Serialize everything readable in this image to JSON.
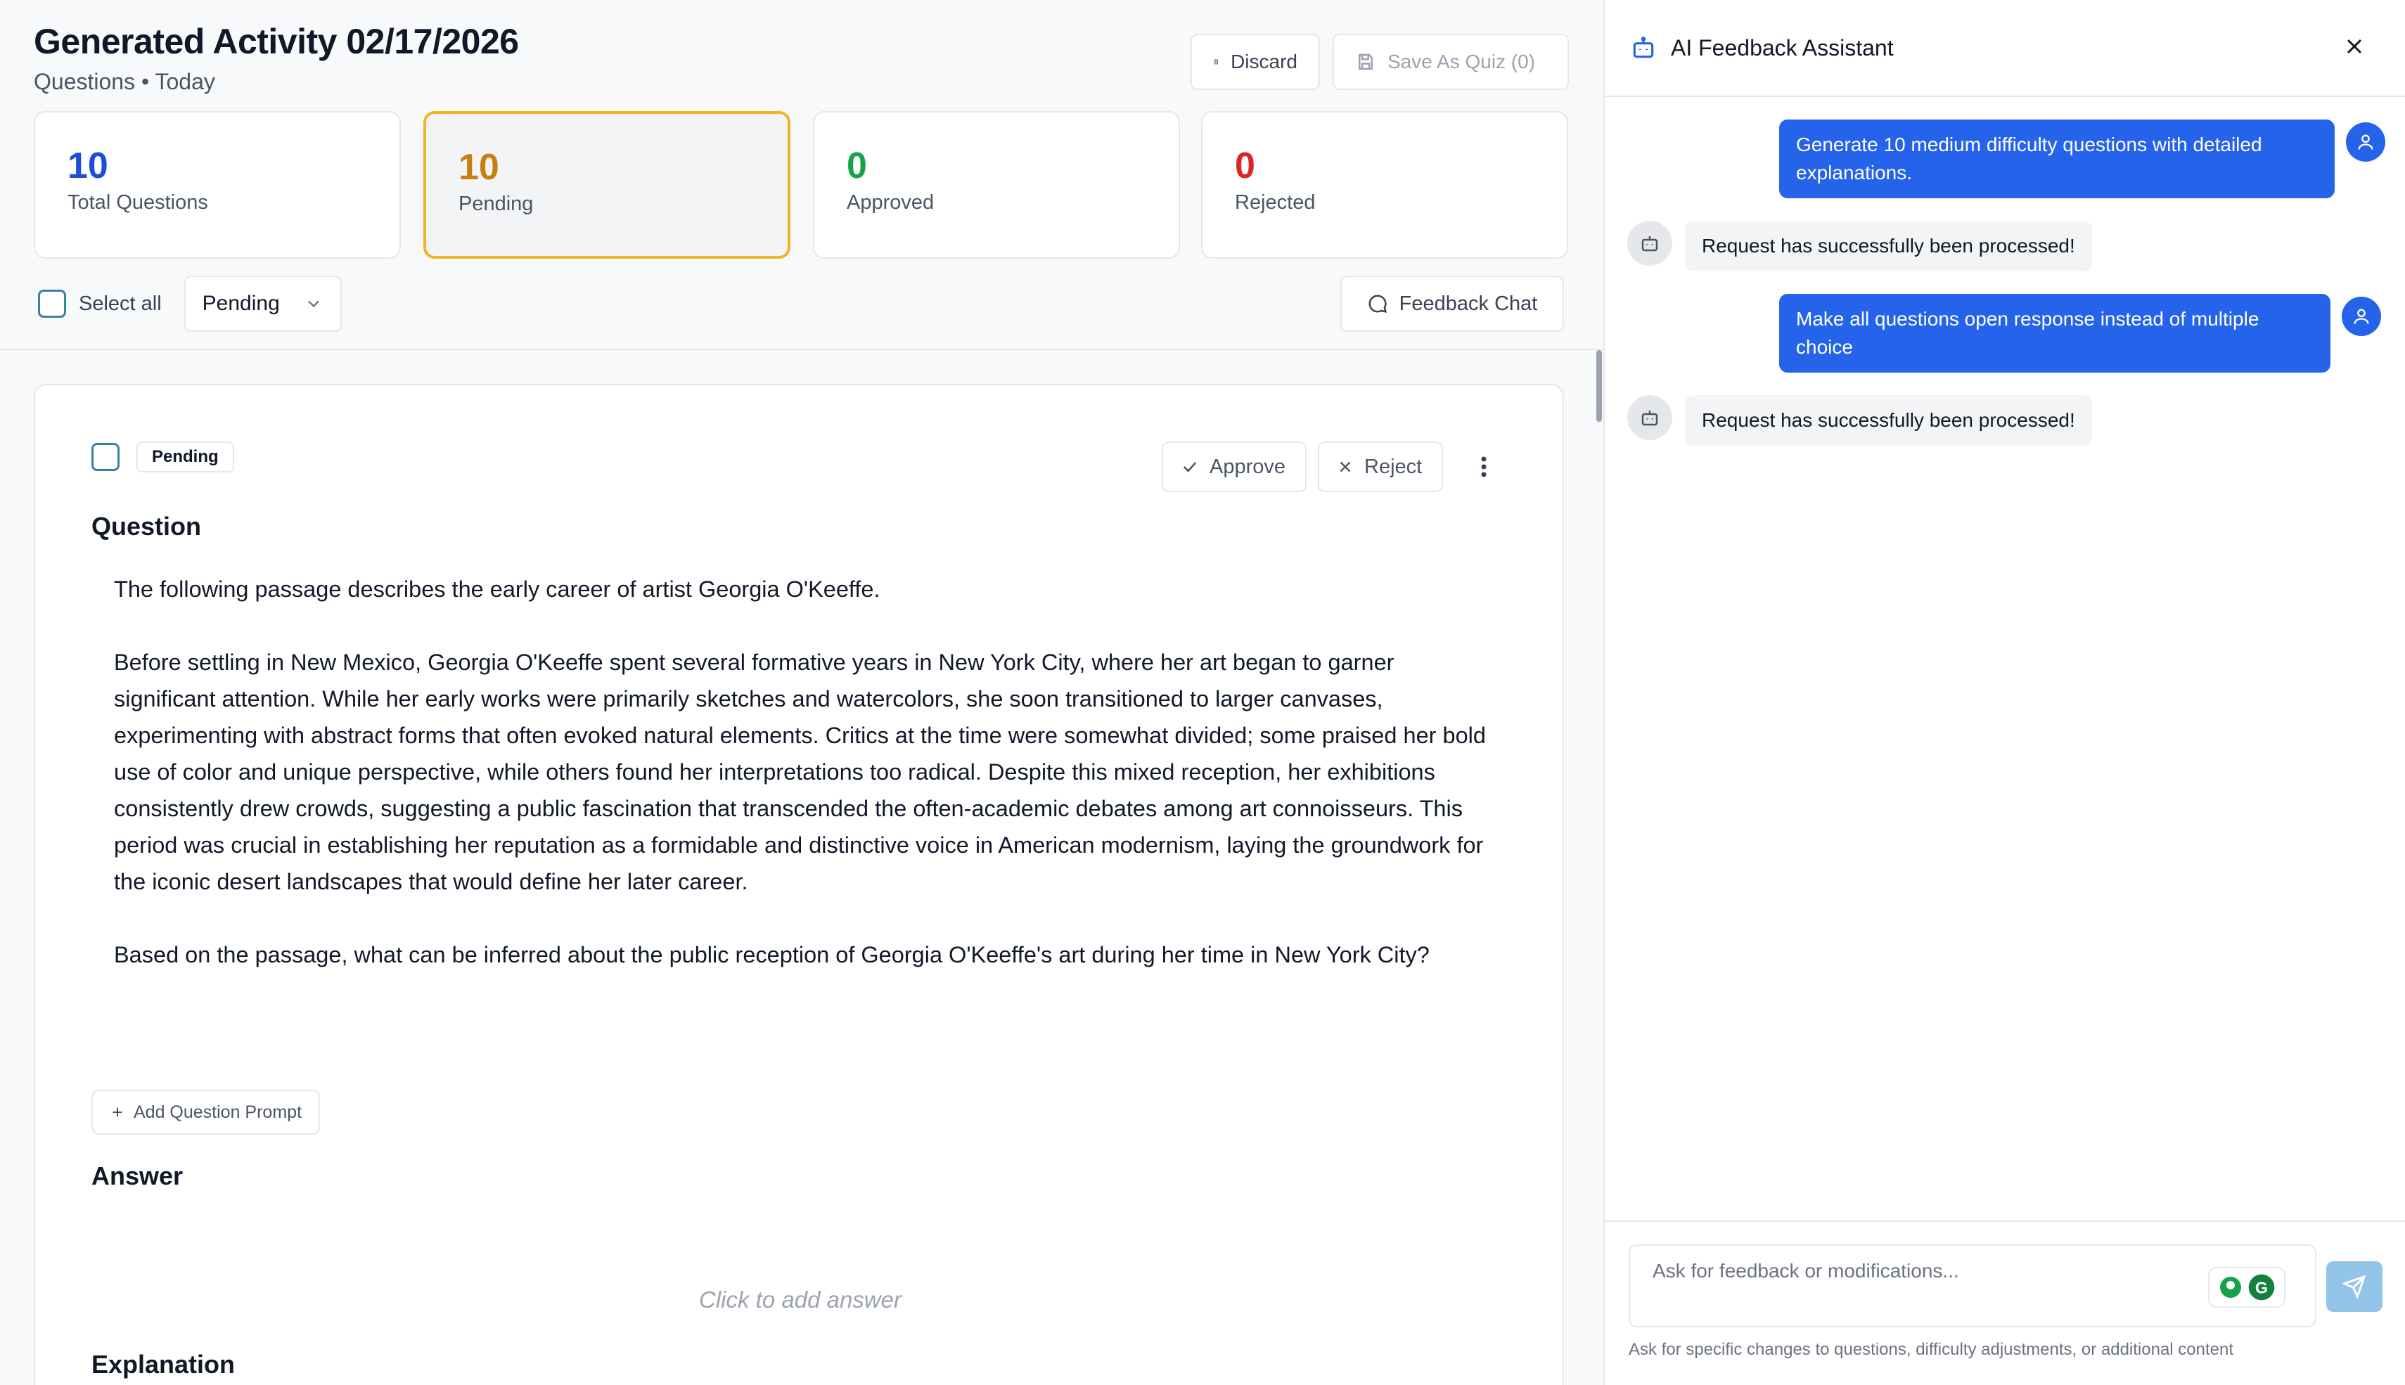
{
  "header": {
    "title": "Generated Activity 02/17/2026",
    "subtitle": "Questions • Today",
    "discard_label": "Discard",
    "save_label": "Save As Quiz (0)"
  },
  "stats": [
    {
      "value": "10",
      "label": "Total Questions",
      "color": "#1d4ed8"
    },
    {
      "value": "10",
      "label": "Pending",
      "color": "#c77f12"
    },
    {
      "value": "0",
      "label": "Approved",
      "color": "#16a34a"
    },
    {
      "value": "0",
      "label": "Rejected",
      "color": "#dc2626"
    }
  ],
  "filters": {
    "select_all_label": "Select all",
    "status_selected": "Pending",
    "feedback_chat_label": "Feedback Chat"
  },
  "card": {
    "status_badge": "Pending",
    "approve_label": "Approve",
    "reject_label": "Reject",
    "question_heading": "Question",
    "question_text": "The following passage describes the early career of artist Georgia O'Keeffe.\n\nBefore settling in New Mexico, Georgia O'Keeffe spent several formative years in New York City, where her art began to garner significant attention. While her early works were primarily sketches and watercolors, she soon transitioned to larger canvases, experimenting with abstract forms that often evoked natural elements. Critics at the time were somewhat divided; some praised her bold use of color and unique perspective, while others found her interpretations too radical. Despite this mixed reception, her exhibitions consistently drew crowds, suggesting a public fascination that transcended the often-academic debates among art connoisseurs. This period was crucial in establishing her reputation as a formidable and distinctive voice in American modernism, laying the groundwork for the iconic desert landscapes that would define her later career.\n\nBased on the passage, what can be inferred about the public reception of Georgia O'Keeffe's art during her time in New York City?",
    "add_prompt_label": "Add Question Prompt",
    "answer_heading": "Answer",
    "answer_placeholder": "Click to add answer",
    "explanation_heading": "Explanation"
  },
  "assistant": {
    "title": "AI Feedback Assistant",
    "messages": [
      {
        "role": "user",
        "text": "Generate 10 medium difficulty questions with detailed explanations."
      },
      {
        "role": "bot",
        "text": "Request has successfully been processed!"
      },
      {
        "role": "user",
        "text": "Make all questions open response instead of multiple choice"
      },
      {
        "role": "bot",
        "text": "Request has successfully been processed!"
      }
    ],
    "input_placeholder": "Ask for feedback or modifications...",
    "hint": "Ask for specific changes to questions, difficulty adjustments, or additional content"
  }
}
